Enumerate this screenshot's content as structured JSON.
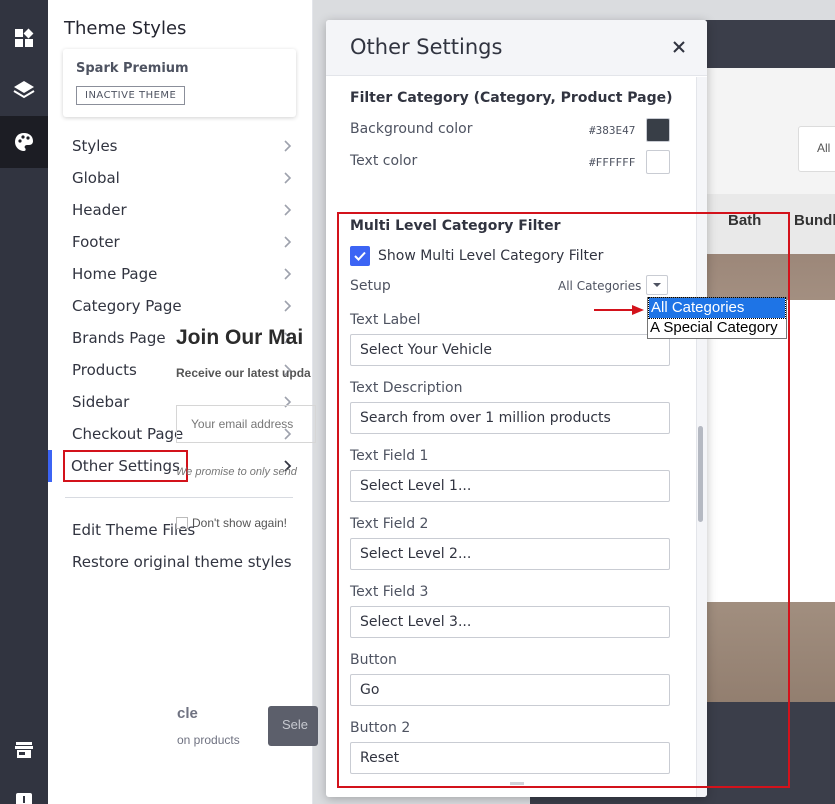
{
  "theme_panel": {
    "title": "Theme Styles",
    "theme_name": "Spark Premium",
    "theme_badge": "INACTIVE THEME",
    "nav": [
      {
        "label": "Styles"
      },
      {
        "label": "Global"
      },
      {
        "label": "Header"
      },
      {
        "label": "Footer"
      },
      {
        "label": "Home Page"
      },
      {
        "label": "Category Page"
      },
      {
        "label": "Brands Page"
      },
      {
        "label": "Products"
      },
      {
        "label": "Sidebar"
      },
      {
        "label": "Checkout Page"
      },
      {
        "label": "Other Settings"
      }
    ],
    "links": [
      "Edit Theme Files",
      "Restore original theme styles"
    ]
  },
  "rail_icons": [
    "dashboard-icon",
    "layers-icon",
    "palette-icon",
    "storefront-icon",
    "alert-icon"
  ],
  "modal": {
    "title": "Other Settings",
    "filter_category": {
      "title": "Filter Category (Category, Product Page)",
      "bg_label": "Background color",
      "bg_hex": "#383E47",
      "text_label": "Text color",
      "text_hex": "#FFFFFF"
    },
    "multi_level": {
      "title": "Multi Level Category Filter",
      "show_label": "Show Multi Level Category Filter",
      "show_checked": true,
      "setup_label": "Setup",
      "setup_value": "All Categories",
      "setup_options": [
        "All Categories",
        "A Special Category"
      ],
      "fields": [
        {
          "label": "Text Label",
          "value": "Select Your Vehicle"
        },
        {
          "label": "Text Description",
          "value": "Search from over 1 million products"
        },
        {
          "label": "Text Field 1",
          "value": "Select Level 1..."
        },
        {
          "label": "Text Field 2",
          "value": "Select Level 2..."
        },
        {
          "label": "Text Field 3",
          "value": "Select Level 3..."
        },
        {
          "label": "Button",
          "value": "Go"
        },
        {
          "label": "Button 2",
          "value": "Reset"
        }
      ]
    }
  },
  "preview": {
    "search_all": "All",
    "tab_bath": "Bath",
    "tab_bundle": "Bundl",
    "popup_title": "Join Our Mai",
    "popup_sub": "Receive our latest upda",
    "email_placeholder": "Your email address",
    "promise": "We promise to only send",
    "dont_show": "Don't show again!",
    "footer_title": "cle",
    "footer_sub": "on products",
    "footer_btn": "Sele"
  },
  "colors": {
    "accent": "#3C64F4",
    "highlight_red": "#D3121B",
    "rail_bg": "#313440",
    "swatch_bg": "#383E47",
    "swatch_text": "#FFFFFF"
  }
}
